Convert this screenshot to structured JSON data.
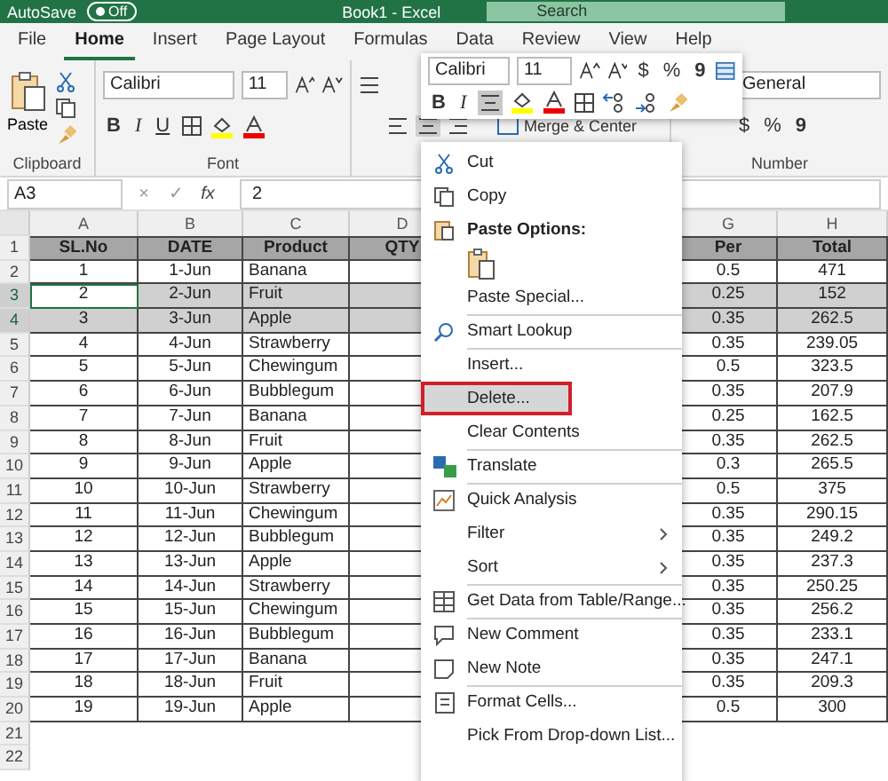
{
  "title_bar": {
    "autosave": "AutoSave",
    "toggle": {
      "label": "Off",
      "on": false
    },
    "title": "Book1 - Excel",
    "search": "Search"
  },
  "tabs": [
    {
      "label": "File",
      "selected": false
    },
    {
      "label": "Home",
      "selected": true
    },
    {
      "label": "Insert",
      "selected": false
    },
    {
      "label": "Page Layout",
      "selected": false
    },
    {
      "label": "Formulas",
      "selected": false
    },
    {
      "label": "Data",
      "selected": false
    },
    {
      "label": "Review",
      "selected": false
    },
    {
      "label": "View",
      "selected": false
    },
    {
      "label": "Help",
      "selected": false
    }
  ],
  "ribbon": {
    "clipboard": {
      "paste": "Paste",
      "label": "Clipboard"
    },
    "font": {
      "name": "Calibri",
      "size": "11",
      "bold": "B",
      "italic": "I",
      "underline": "U",
      "label": "Font"
    },
    "alignment": {
      "merge": "Merge & Center"
    },
    "number": {
      "format": "General",
      "currency": "$",
      "percent": "%",
      "comma": "9",
      "label": "Number"
    }
  },
  "formula_bar": {
    "name_box": "A3",
    "cancel": "×",
    "enter": "✓",
    "fx": "fx",
    "value": "2"
  },
  "mini_toolbar": {
    "font": "Calibri",
    "size": "11",
    "currency": "$",
    "percent": "%",
    "comma": "9",
    "bold": "B",
    "italic": "I"
  },
  "columns": [
    {
      "letter": "A",
      "heading": "SL.No"
    },
    {
      "letter": "B",
      "heading": "DATE"
    },
    {
      "letter": "C",
      "heading": "Product"
    },
    {
      "letter": "D",
      "heading": "QTY"
    },
    {
      "letter": "G",
      "heading": "Per"
    },
    {
      "letter": "H",
      "heading": "Total"
    }
  ],
  "header_row": "1",
  "rows": [
    {
      "row": "2",
      "sl": "1",
      "date": "1-Jun",
      "product": "Banana",
      "per": "0.5",
      "total": "471",
      "selected": false,
      "active": false
    },
    {
      "row": "3",
      "sl": "2",
      "date": "2-Jun",
      "product": "Fruit",
      "per": "0.25",
      "total": "152",
      "selected": true,
      "active": true
    },
    {
      "row": "4",
      "sl": "3",
      "date": "3-Jun",
      "product": "Apple",
      "per": "0.35",
      "total": "262.5",
      "selected": true,
      "active": false
    },
    {
      "row": "5",
      "sl": "4",
      "date": "4-Jun",
      "product": "Strawberry",
      "per": "0.35",
      "total": "239.05",
      "selected": false,
      "active": false
    },
    {
      "row": "6",
      "sl": "5",
      "date": "5-Jun",
      "product": "Chewingum",
      "per": "0.5",
      "total": "323.5",
      "selected": false,
      "active": false
    },
    {
      "row": "7",
      "sl": "6",
      "date": "6-Jun",
      "product": "Bubblegum",
      "per": "0.35",
      "total": "207.9",
      "selected": false,
      "active": false
    },
    {
      "row": "8",
      "sl": "7",
      "date": "7-Jun",
      "product": "Banana",
      "per": "0.25",
      "total": "162.5",
      "selected": false,
      "active": false
    },
    {
      "row": "9",
      "sl": "8",
      "date": "8-Jun",
      "product": "Fruit",
      "per": "0.35",
      "total": "262.5",
      "selected": false,
      "active": false
    },
    {
      "row": "10",
      "sl": "9",
      "date": "9-Jun",
      "product": "Apple",
      "per": "0.3",
      "total": "265.5",
      "selected": false,
      "active": false
    },
    {
      "row": "11",
      "sl": "10",
      "date": "10-Jun",
      "product": "Strawberry",
      "per": "0.5",
      "total": "375",
      "selected": false,
      "active": false
    },
    {
      "row": "12",
      "sl": "11",
      "date": "11-Jun",
      "product": "Chewingum",
      "per": "0.35",
      "total": "290.15",
      "selected": false,
      "active": false
    },
    {
      "row": "13",
      "sl": "12",
      "date": "12-Jun",
      "product": "Bubblegum",
      "per": "0.35",
      "total": "249.2",
      "selected": false,
      "active": false
    },
    {
      "row": "14",
      "sl": "13",
      "date": "13-Jun",
      "product": "Apple",
      "per": "0.35",
      "total": "237.3",
      "selected": false,
      "active": false
    },
    {
      "row": "15",
      "sl": "14",
      "date": "14-Jun",
      "product": "Strawberry",
      "per": "0.35",
      "total": "250.25",
      "selected": false,
      "active": false
    },
    {
      "row": "16",
      "sl": "15",
      "date": "15-Jun",
      "product": "Chewingum",
      "per": "0.35",
      "total": "256.2",
      "selected": false,
      "active": false
    },
    {
      "row": "17",
      "sl": "16",
      "date": "16-Jun",
      "product": "Bubblegum",
      "per": "0.35",
      "total": "233.1",
      "selected": false,
      "active": false
    },
    {
      "row": "18",
      "sl": "17",
      "date": "17-Jun",
      "product": "Banana",
      "per": "0.35",
      "total": "247.1",
      "selected": false,
      "active": false
    },
    {
      "row": "19",
      "sl": "18",
      "date": "18-Jun",
      "product": "Fruit",
      "per": "0.35",
      "total": "209.3",
      "selected": false,
      "active": false
    },
    {
      "row": "20",
      "sl": "19",
      "date": "19-Jun",
      "product": "Apple",
      "per": "0.5",
      "total": "300",
      "selected": false,
      "active": false
    }
  ],
  "empty_rows": [
    "21",
    "22"
  ],
  "context_menu": [
    {
      "kind": "item",
      "label": "Cut",
      "separator_before": false,
      "selected": false,
      "outlined": false,
      "submenu": false
    },
    {
      "kind": "item",
      "label": "Copy",
      "separator_before": false,
      "selected": false,
      "outlined": false,
      "submenu": false
    },
    {
      "kind": "heading",
      "label": "Paste Options:",
      "separator_before": false,
      "selected": false,
      "outlined": false,
      "submenu": false
    },
    {
      "kind": "paste-option",
      "separator_before": false,
      "selected": false,
      "outlined": false,
      "submenu": false
    },
    {
      "kind": "item",
      "label": "Paste Special...",
      "separator_before": false,
      "selected": false,
      "outlined": false,
      "submenu": false
    },
    {
      "kind": "item",
      "label": "Smart Lookup",
      "separator_before": true,
      "selected": false,
      "outlined": false,
      "submenu": false
    },
    {
      "kind": "item",
      "label": "Insert...",
      "separator_before": true,
      "selected": false,
      "outlined": false,
      "submenu": false
    },
    {
      "kind": "item",
      "label": "Delete...",
      "separator_before": false,
      "selected": true,
      "outlined": true,
      "submenu": false
    },
    {
      "kind": "item",
      "label": "Clear Contents",
      "separator_before": false,
      "selected": false,
      "outlined": false,
      "submenu": false
    },
    {
      "kind": "item",
      "label": "Translate",
      "separator_before": true,
      "selected": false,
      "outlined": false,
      "submenu": false
    },
    {
      "kind": "item",
      "label": "Quick Analysis",
      "separator_before": true,
      "selected": false,
      "outlined": false,
      "submenu": false
    },
    {
      "kind": "item",
      "label": "Filter",
      "separator_before": false,
      "selected": false,
      "outlined": false,
      "submenu": true
    },
    {
      "kind": "item",
      "label": "Sort",
      "separator_before": false,
      "selected": false,
      "outlined": false,
      "submenu": true
    },
    {
      "kind": "item",
      "label": "Get Data from Table/Range...",
      "separator_before": true,
      "selected": false,
      "outlined": false,
      "submenu": false
    },
    {
      "kind": "item",
      "label": "New Comment",
      "separator_before": true,
      "selected": false,
      "outlined": false,
      "submenu": false
    },
    {
      "kind": "item",
      "label": "New Note",
      "separator_before": false,
      "selected": false,
      "outlined": false,
      "submenu": false
    },
    {
      "kind": "item",
      "label": "Format Cells...",
      "separator_before": true,
      "selected": false,
      "outlined": false,
      "submenu": false
    },
    {
      "kind": "item",
      "label": "Pick From Drop-down List...",
      "separator_before": false,
      "selected": false,
      "outlined": false,
      "submenu": false
    }
  ]
}
